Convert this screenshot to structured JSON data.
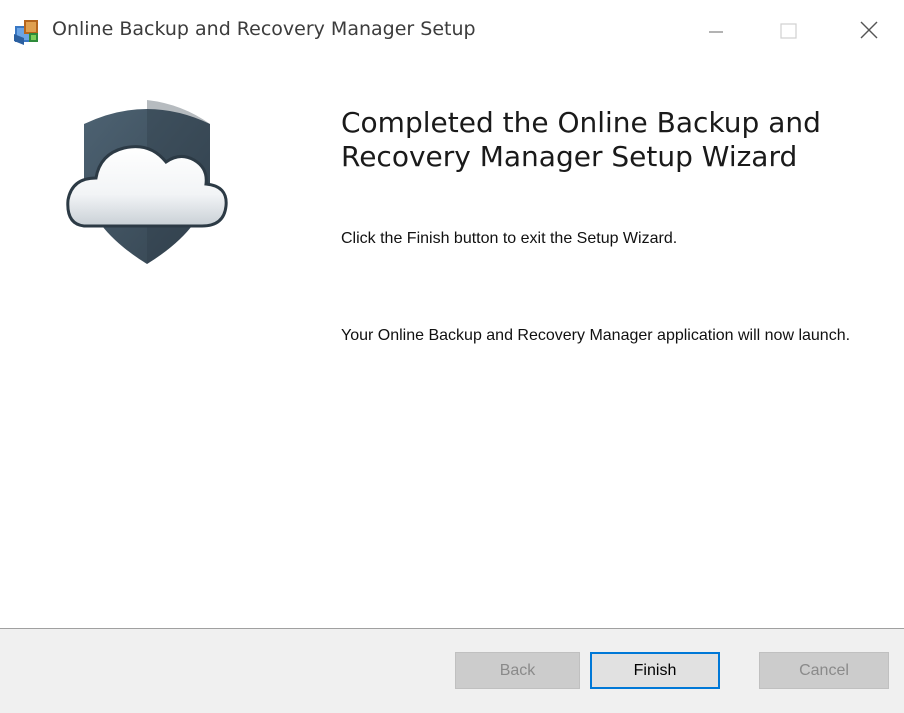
{
  "window": {
    "title": "Online Backup and Recovery Manager Setup",
    "icon": "installer-package-icon"
  },
  "caption_buttons": {
    "minimize": "minimize-icon",
    "maximize": "maximize-icon",
    "close": "close-icon"
  },
  "banner": {
    "logo": "cloud-shield-logo"
  },
  "content": {
    "heading": "Completed the Online Backup and Recovery Manager Setup Wizard",
    "instruction": "Click the Finish button to exit the Setup Wizard.",
    "launch_note": "Your Online Backup and Recovery Manager application will now launch."
  },
  "footer": {
    "back_label": "Back",
    "finish_label": "Finish",
    "cancel_label": "Cancel",
    "back_enabled": false,
    "finish_enabled": true,
    "cancel_enabled": false
  },
  "colors": {
    "accent": "#0078d7",
    "shield": "#425564",
    "footer_bg": "#f0f0f0"
  }
}
